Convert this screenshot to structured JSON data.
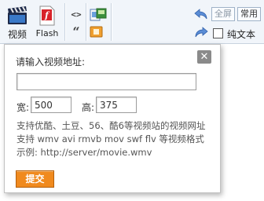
{
  "toolbar": {
    "video_label": "视频",
    "flash_label": "Flash",
    "code_glyph": "<>",
    "quote_glyph": "“",
    "fullscreen_label": "全屏",
    "common_label": "常用",
    "plaintext_label": "纯文本"
  },
  "dialog": {
    "title": "请输入视频地址:",
    "url_value": "",
    "width_label": "宽:",
    "width_value": "500",
    "height_label": "高:",
    "height_value": "375",
    "help_lines": [
      "支持优酷、土豆、56、酷6等视频站的视频网址",
      "支持 wmv avi rmvb mov swf flv 等视频格式",
      "示例: http://server/movie.wmv"
    ],
    "submit_label": "提交"
  },
  "colors": {
    "toolbar_bg": "#f1f5fa",
    "submit_bg": "#f08a1e"
  },
  "icons": [
    "video-clapper-icon",
    "flash-icon",
    "code-icon",
    "quote-icon",
    "image-icon",
    "attachment-icon",
    "undo-icon",
    "redo-icon",
    "close-icon"
  ]
}
